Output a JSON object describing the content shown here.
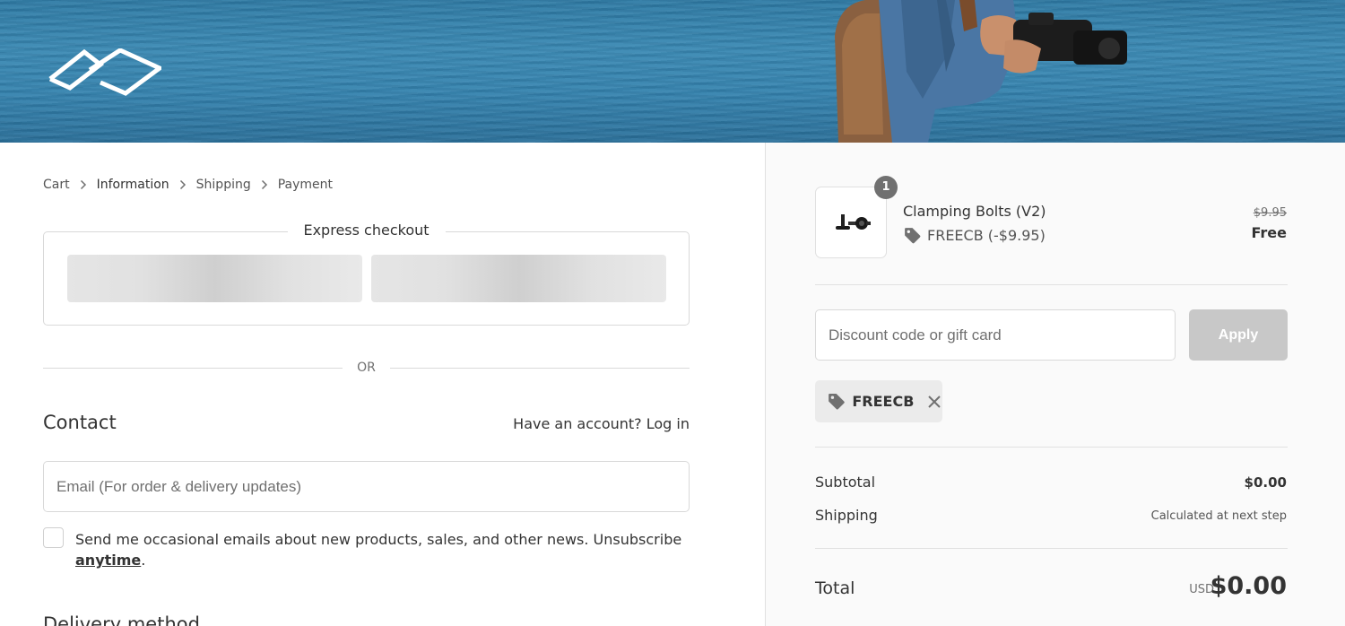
{
  "breadcrumb": {
    "items": [
      {
        "label": "Cart"
      },
      {
        "label": "Information"
      },
      {
        "label": "Shipping"
      },
      {
        "label": "Payment"
      }
    ]
  },
  "express": {
    "title": "Express checkout"
  },
  "divider_or": "OR",
  "contact": {
    "title": "Contact",
    "account_prompt": "Have an account?",
    "login_link": "Log in",
    "email_placeholder": "Email (For order & delivery updates)",
    "newsletter_text": "Send me occasional emails about new products, sales, and other news. Unsubscribe",
    "newsletter_link": "anytime",
    "newsletter_end": "."
  },
  "delivery": {
    "title": "Delivery method"
  },
  "summary": {
    "product": {
      "name": "Clamping Bolts (V2)",
      "quantity": "1",
      "discount": "FREECB (-$9.95)",
      "price_original": "$9.95",
      "price_final": "Free"
    },
    "discount_placeholder": "Discount code or gift card",
    "apply_label": "Apply",
    "applied_code": "FREECB",
    "subtotal_label": "Subtotal",
    "subtotal_value": "$0.00",
    "shipping_label": "Shipping",
    "shipping_value": "Calculated at next step",
    "total_label": "Total",
    "total_currency": "USD",
    "total_value": "$0.00"
  },
  "colors": {
    "banner_water": "#3582ad",
    "apply_disabled": "#c8c8c8",
    "sidebar_bg": "#fafafa"
  }
}
